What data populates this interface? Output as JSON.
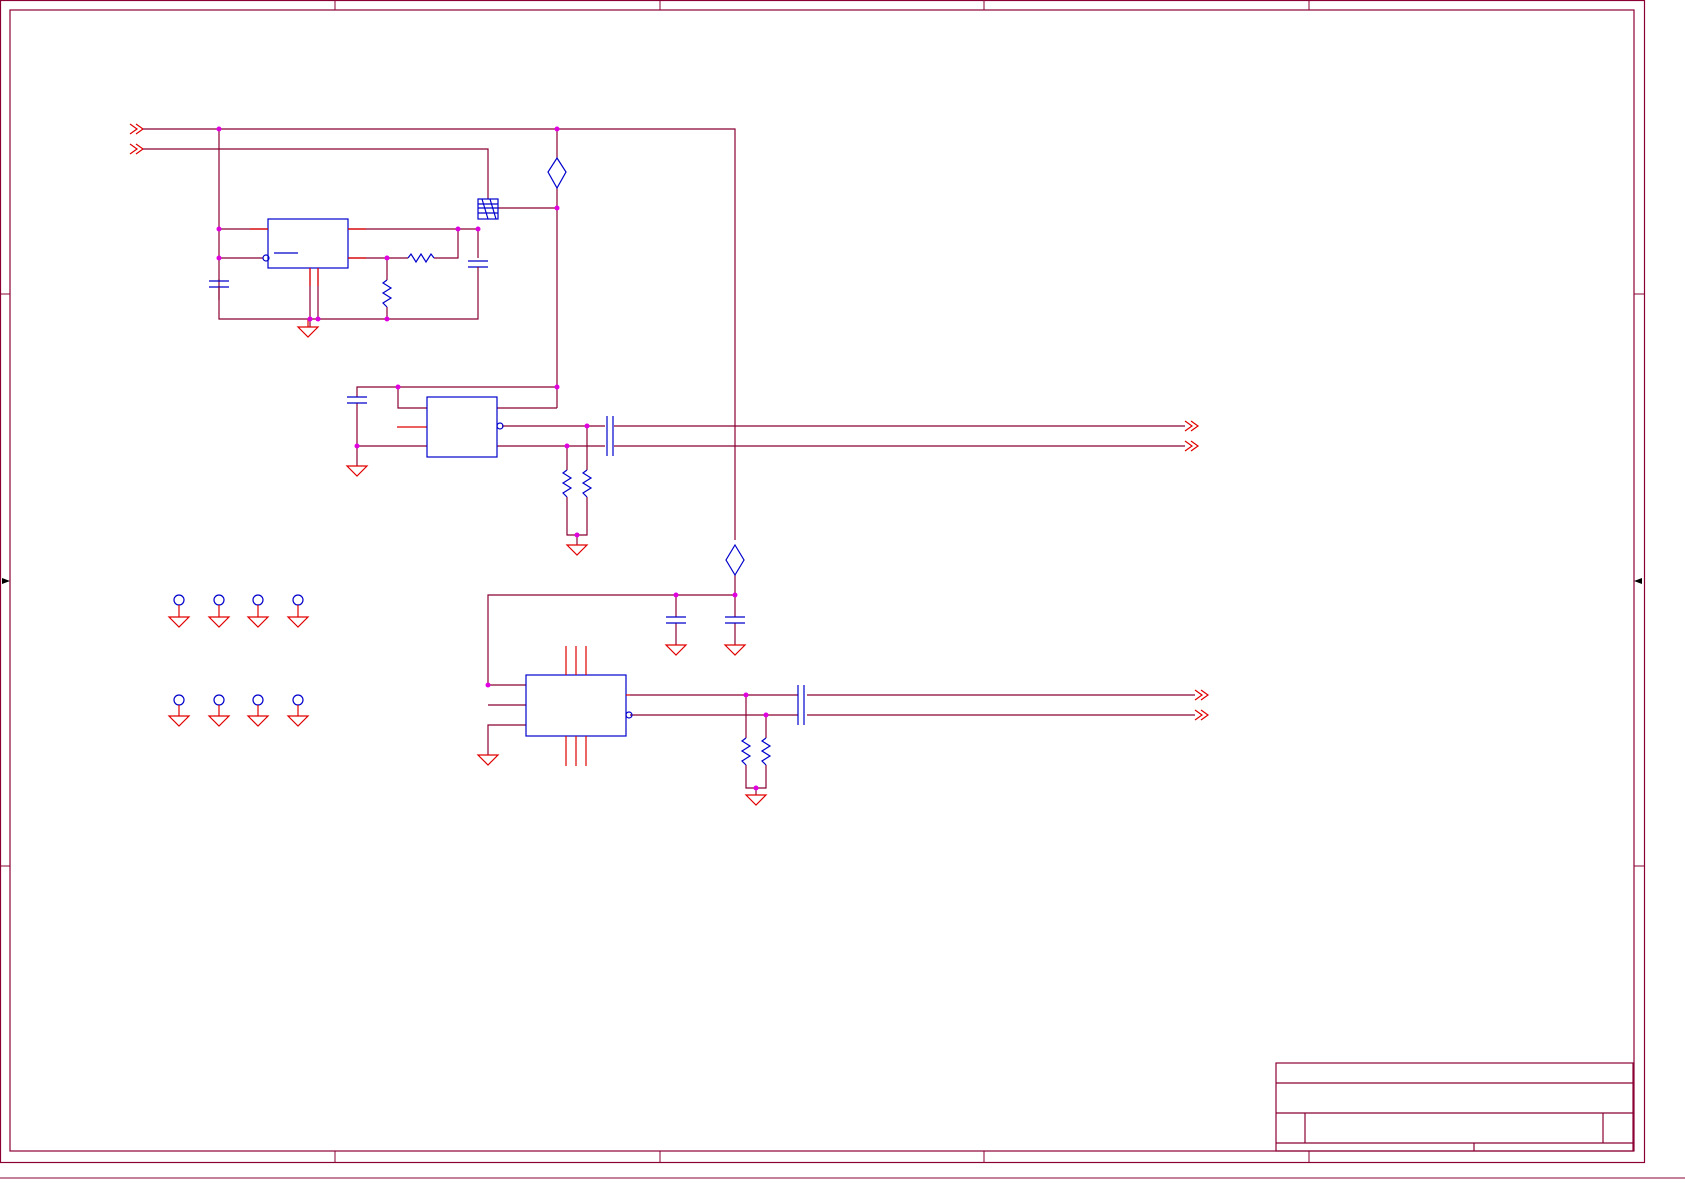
{
  "schematic": {
    "background": "#ffffff",
    "colors": {
      "wire": "#8b0033",
      "pin": "#e00000",
      "part": "#0000cc",
      "junction": "#e000e0"
    },
    "components": {
      "regulator_ic": "rectangle-with-bar",
      "buffer_ic_upper": "rectangle",
      "buffer_ic_lower": "rectangle",
      "fuses": [
        "diamond-fuse-upper",
        "diamond-fuse-lower"
      ],
      "test_points": 8
    },
    "labels": {}
  }
}
